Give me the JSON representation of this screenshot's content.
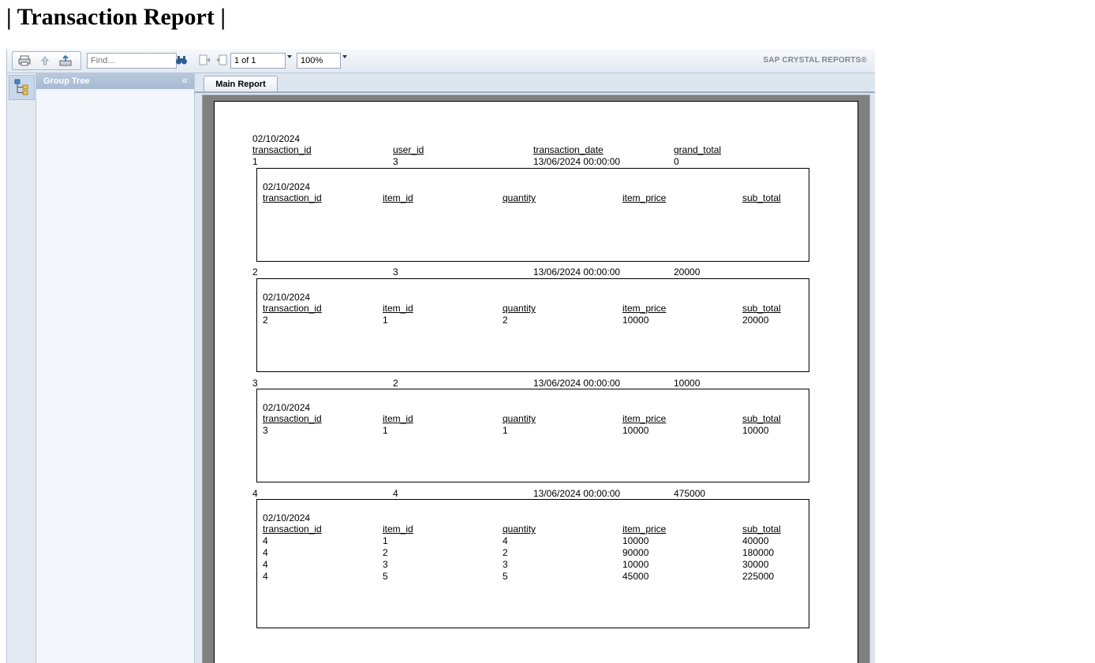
{
  "page_title": "| Transaction Report |",
  "toolbar": {
    "find_placeholder": "Find...",
    "page_value": "1 of 1",
    "zoom_value": "100%",
    "brand": "SAP CRYSTAL REPORTS®",
    "icons": [
      "print-icon",
      "upload-icon",
      "export-icon",
      "binoculars-icon",
      "first-page-icon",
      "previous-page-icon"
    ]
  },
  "group_tree": {
    "title": "Group Tree",
    "collapse_glyph": "«"
  },
  "tabs": [
    {
      "label": "Main Report"
    }
  ],
  "report": {
    "date": "02/10/2024",
    "main_headers": [
      "transaction_id",
      "user_id",
      "transaction_date",
      "grand_total"
    ],
    "sub_headers": [
      "transaction_id",
      "item_id",
      "quantity",
      "item_price",
      "sub_total"
    ],
    "transactions": [
      {
        "row": [
          "1",
          "3",
          "13/06/2024 00:00:00",
          "0"
        ],
        "date": "02/10/2024",
        "items": []
      },
      {
        "row": [
          "2",
          "3",
          "13/06/2024 00:00:00",
          "20000"
        ],
        "date": "02/10/2024",
        "items": [
          [
            "2",
            "1",
            "2",
            "10000",
            "20000"
          ]
        ]
      },
      {
        "row": [
          "3",
          "2",
          "13/06/2024 00:00:00",
          "10000"
        ],
        "date": "02/10/2024",
        "items": [
          [
            "3",
            "1",
            "1",
            "10000",
            "10000"
          ]
        ]
      },
      {
        "row": [
          "4",
          "4",
          "13/06/2024 00:00:00",
          "475000"
        ],
        "date": "02/10/2024",
        "items": [
          [
            "4",
            "1",
            "4",
            "10000",
            "40000"
          ],
          [
            "4",
            "2",
            "2",
            "90000",
            "180000"
          ],
          [
            "4",
            "3",
            "3",
            "10000",
            "30000"
          ],
          [
            "4",
            "5",
            "5",
            "45000",
            "225000"
          ]
        ]
      }
    ]
  }
}
